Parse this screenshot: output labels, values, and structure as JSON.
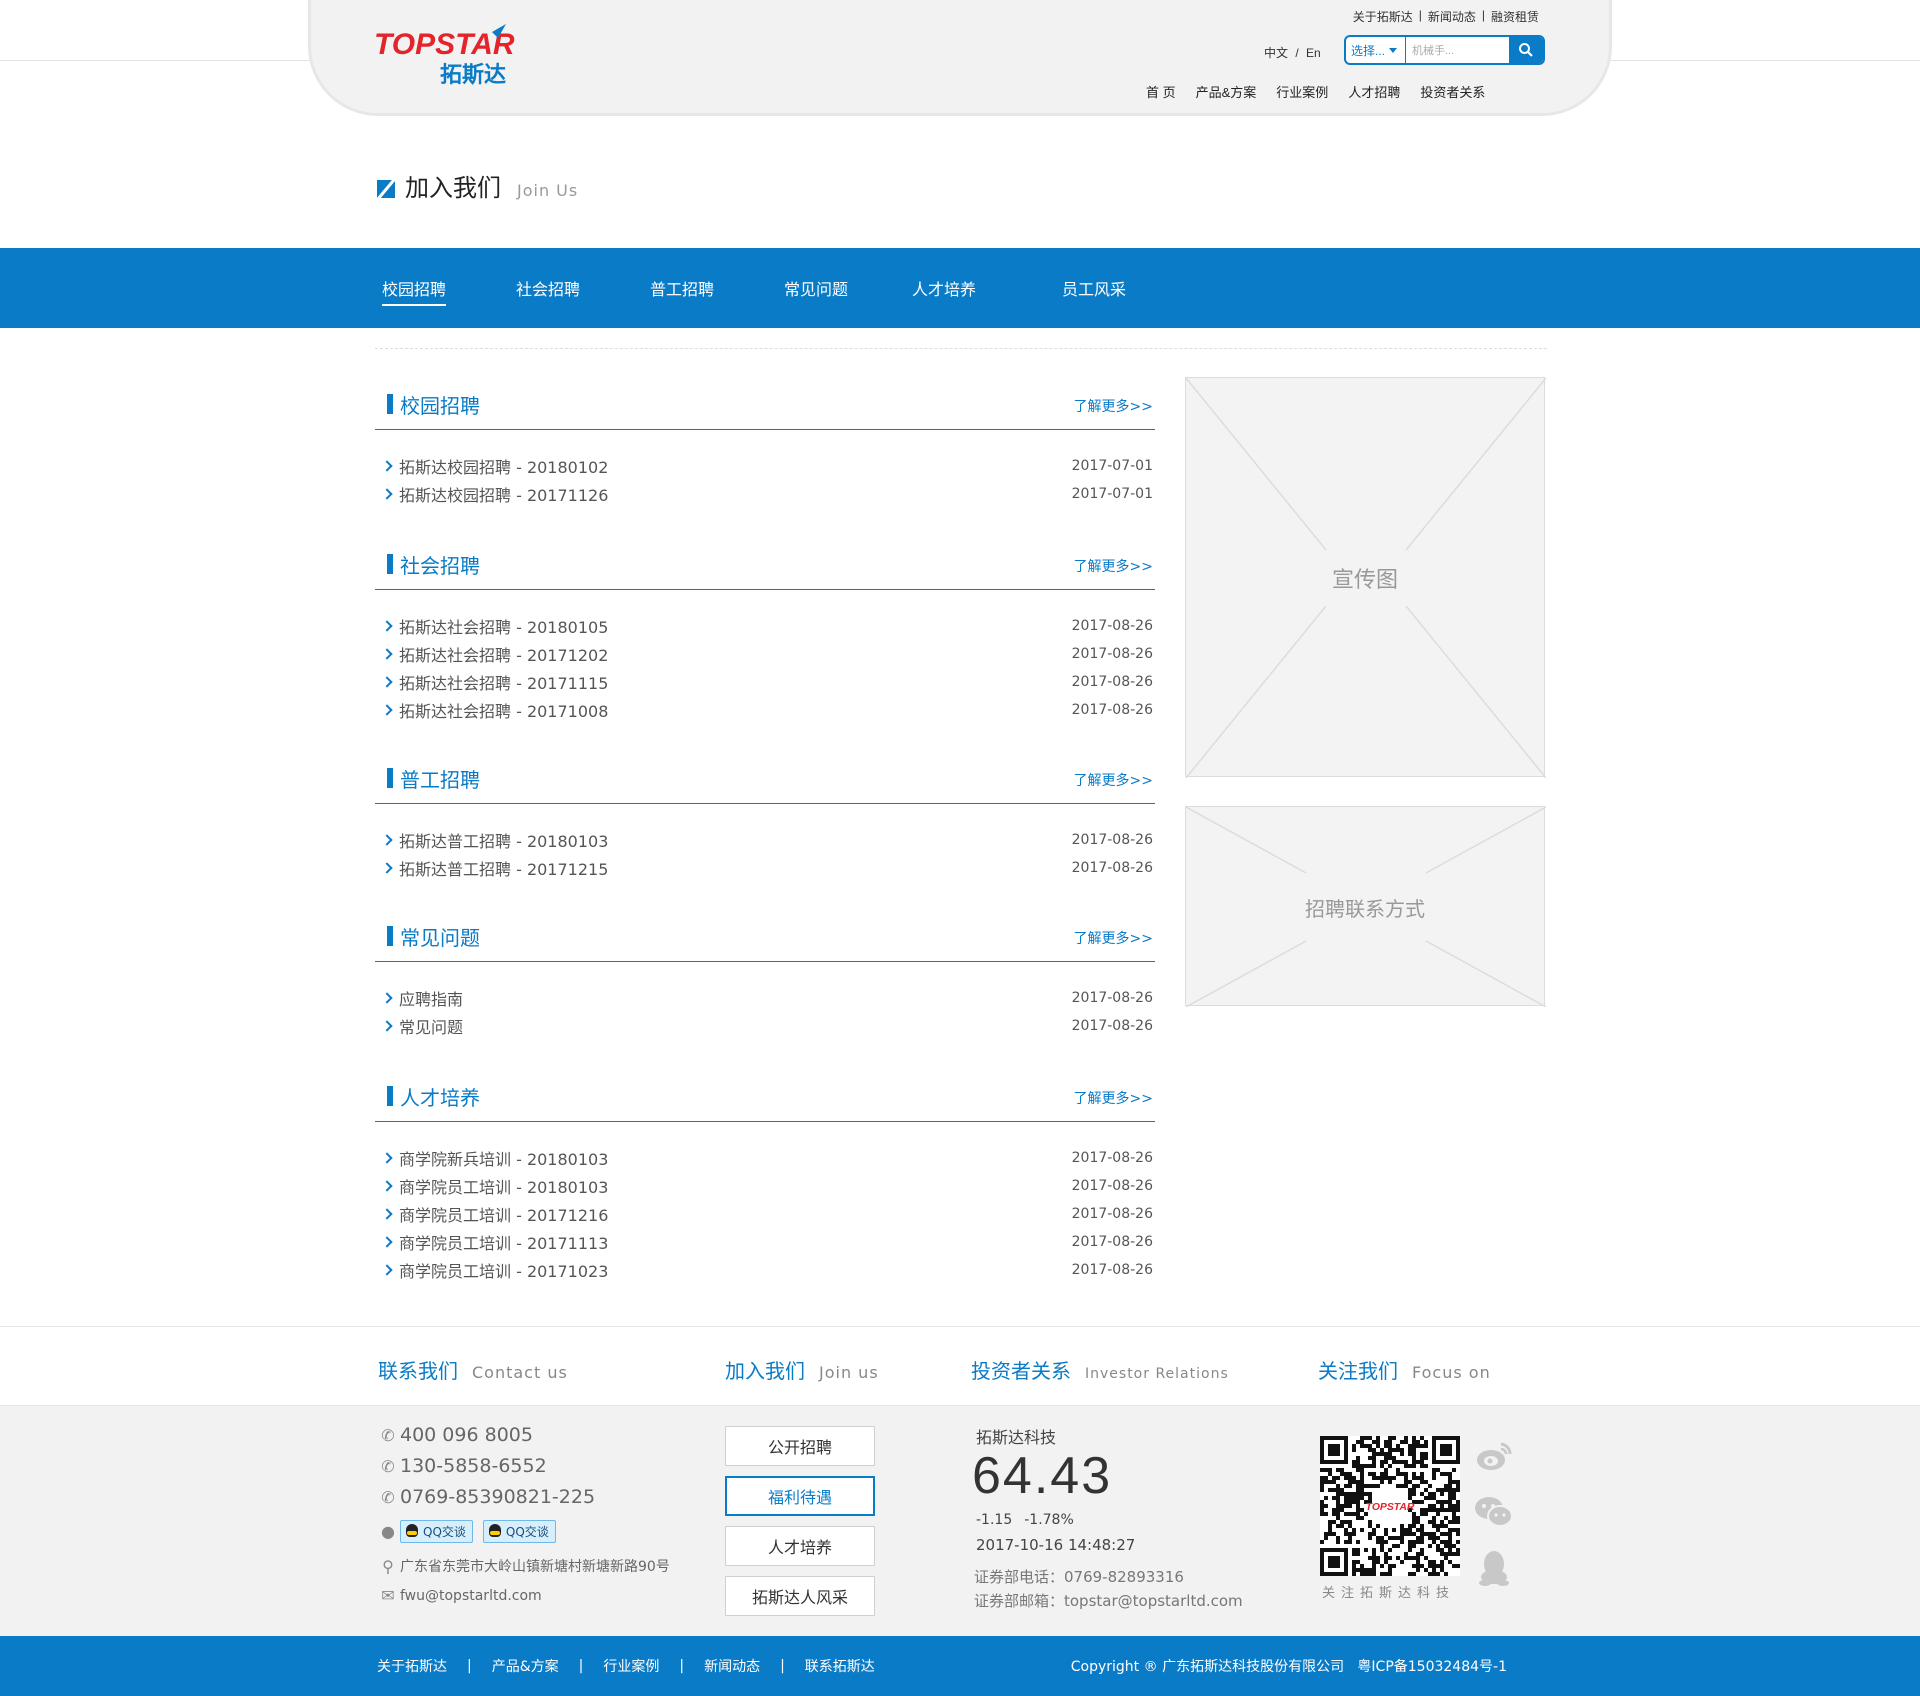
{
  "header": {
    "logo_text": "TOPSTAR",
    "logo_cn": "拓斯达",
    "top_links": [
      "关于拓斯达",
      "新闻动态",
      "融资租赁"
    ],
    "lang_cn": "中文",
    "lang_sep": "/",
    "lang_en": "En",
    "search_select": "选择...",
    "search_placeholder": "机械手...",
    "nav": [
      "首 页",
      "产品&方案",
      "行业案例",
      "人才招聘",
      "投资者关系"
    ]
  },
  "page_title": {
    "cn": "加入我们",
    "en": "Join Us"
  },
  "sub_nav": [
    "校园招聘",
    "社会招聘",
    "普工招聘",
    "常见问题",
    "人才培养",
    "员工风采"
  ],
  "more_label": "了解更多>>",
  "sections": [
    {
      "title": "校园招聘",
      "items": [
        {
          "text": "拓斯达校园招聘 - 20180102",
          "date": "2017-07-01"
        },
        {
          "text": "拓斯达校园招聘 - 20171126",
          "date": "2017-07-01"
        }
      ]
    },
    {
      "title": "社会招聘",
      "items": [
        {
          "text": "拓斯达社会招聘 - 20180105",
          "date": "2017-08-26"
        },
        {
          "text": "拓斯达社会招聘 - 20171202",
          "date": "2017-08-26"
        },
        {
          "text": "拓斯达社会招聘 - 20171115",
          "date": "2017-08-26"
        },
        {
          "text": "拓斯达社会招聘 - 20171008",
          "date": "2017-08-26"
        }
      ]
    },
    {
      "title": "普工招聘",
      "items": [
        {
          "text": "拓斯达普工招聘 - 20180103",
          "date": "2017-08-26"
        },
        {
          "text": "拓斯达普工招聘 - 20171215",
          "date": "2017-08-26"
        }
      ]
    },
    {
      "title": "常见问题",
      "items": [
        {
          "text": "应聘指南",
          "date": "2017-08-26"
        },
        {
          "text": "常见问题",
          "date": "2017-08-26"
        }
      ]
    },
    {
      "title": "人才培养",
      "items": [
        {
          "text": "商学院新兵培训 - 20180103",
          "date": "2017-08-26"
        },
        {
          "text": "商学院员工培训 - 20180103",
          "date": "2017-08-26"
        },
        {
          "text": "商学院员工培训 - 20171216",
          "date": "2017-08-26"
        },
        {
          "text": "商学院员工培训 - 20171113",
          "date": "2017-08-26"
        },
        {
          "text": "商学院员工培训 - 20171023",
          "date": "2017-08-26"
        }
      ]
    }
  ],
  "side": {
    "promo_label": "宣传图",
    "contact_label": "招聘联系方式"
  },
  "footer": {
    "heads": [
      {
        "cn": "联系我们",
        "en": "Contact us"
      },
      {
        "cn": "加入我们",
        "en": "Join us"
      },
      {
        "cn": "投资者关系",
        "en": "Investor Relations"
      },
      {
        "cn": "关注我们",
        "en": "Focus on"
      }
    ],
    "phone1": "400 096 8005",
    "phone2": "130-5858-6552",
    "phone3": "0769-85390821-225",
    "qq_label": "QQ交谈",
    "address": "广东省东莞市大岭山镇新塘村新塘新路90号",
    "email": "fwu@topstarltd.com",
    "join_buttons": [
      "公开招聘",
      "福利待遇",
      "人才培养",
      "拓斯达人风采"
    ],
    "stock": {
      "name": "拓斯达科技",
      "price": "64.43",
      "change": "-1.15",
      "change_pct": "-1.78%",
      "time": "2017-10-16 14:48:27",
      "phone": "证券部电话：0769-82893316",
      "email": "证券部邮箱：topstar@topstarltd.com"
    },
    "qr_caption": "关注拓斯达科技",
    "bottom_links": [
      "关于拓斯达",
      "产品&方案",
      "行业案例",
      "新闻动态",
      "联系拓斯达"
    ],
    "copyright": "Copyright ® 广东拓斯达科技股份有限公司   粤ICP备15032484号-1"
  },
  "colors": {
    "brand_blue": "#0a7bc7",
    "logo_red": "#e3242b"
  }
}
